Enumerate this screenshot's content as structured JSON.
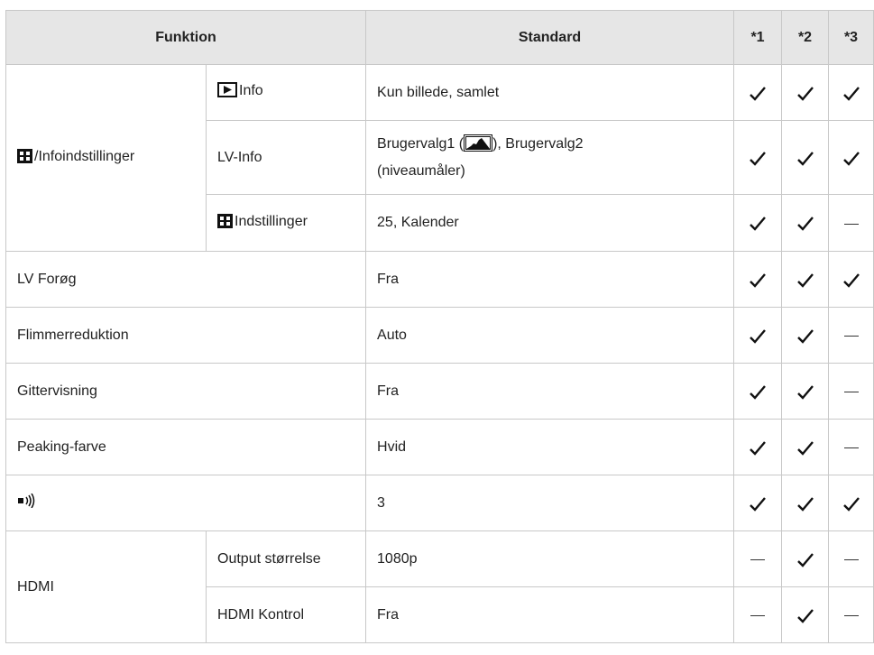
{
  "header": {
    "funktion": "Funktion",
    "standard": "Standard",
    "col1": "*1",
    "col2": "*2",
    "col3": "*3"
  },
  "rows": [
    {
      "group": "/Infoindstillinger",
      "sub": "Info",
      "standard": "Kun billede, samlet",
      "marks": [
        "check",
        "check",
        "check"
      ]
    },
    {
      "group": "",
      "sub": "LV-Info",
      "standard_a": "Brugervalg1 (",
      "standard_b": "), Brugervalg2",
      "standard_c": "(niveaumåler)",
      "marks": [
        "check",
        "check",
        "check"
      ]
    },
    {
      "group": "",
      "sub": "Indstillinger",
      "standard": "25, Kalender",
      "marks": [
        "check",
        "check",
        "dash"
      ]
    },
    {
      "label": "LV Forøg",
      "standard": "Fra",
      "marks": [
        "check",
        "check",
        "check"
      ]
    },
    {
      "label": "Flimmerreduktion",
      "standard": "Auto",
      "marks": [
        "check",
        "check",
        "dash"
      ]
    },
    {
      "label": "Gittervisning",
      "standard": "Fra",
      "marks": [
        "check",
        "check",
        "dash"
      ]
    },
    {
      "label": "Peaking-farve",
      "standard": "Hvid",
      "marks": [
        "check",
        "check",
        "dash"
      ]
    },
    {
      "label": "",
      "icon": "beep-sound-icon",
      "standard": "3",
      "marks": [
        "check",
        "check",
        "check"
      ]
    },
    {
      "group": "HDMI",
      "sub": "Output størrelse",
      "standard": "1080p",
      "marks": [
        "dash",
        "check",
        "dash"
      ]
    },
    {
      "group": "",
      "sub": "HDMI Kontrol",
      "standard": "Fra",
      "marks": [
        "dash",
        "check",
        "dash"
      ]
    }
  ],
  "colors": {
    "header_bg": "#e6e6e6",
    "border": "#c8c8c8",
    "text": "#222222"
  }
}
